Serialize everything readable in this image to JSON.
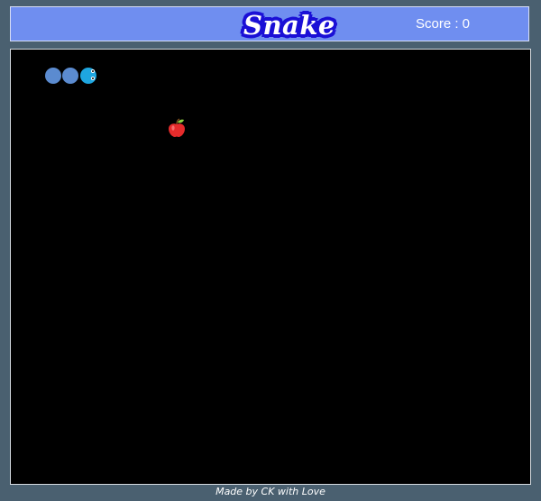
{
  "header": {
    "title": "Snake",
    "score_label": "Score : 0"
  },
  "game": {
    "score": 0,
    "snake": {
      "color": "#5b8bd0",
      "head_color": "#1ea6e0",
      "segments": 3,
      "direction": "right"
    },
    "food": {
      "type": "apple",
      "icon": "apple-icon",
      "color": "#e52b2b"
    },
    "board_color": "#000000"
  },
  "colors": {
    "header_bg": "#6f8ef0",
    "title_outline": "#1b10d6",
    "page_bg": "#4a6070"
  },
  "footer": {
    "text": "Made by CK with Love"
  }
}
